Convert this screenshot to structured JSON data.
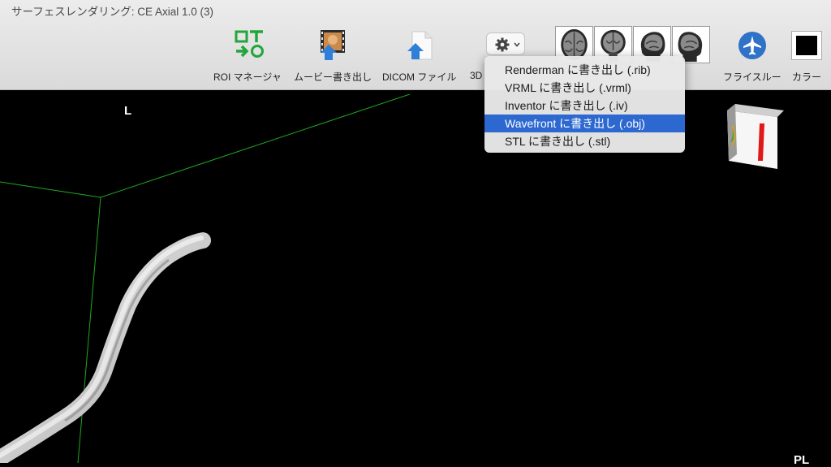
{
  "window": {
    "title": "サーフェスレンダリング: CE Axial 1.0 (3)"
  },
  "toolbar": {
    "roi_label": "ROI マネージャ",
    "movie_label": "ムービー書き出し",
    "dicom_label": "DICOM ファイル",
    "threed_label": "3D",
    "flythrough_label": "フライスルー",
    "color_label": "カラー"
  },
  "menu": {
    "items": [
      {
        "label": "Renderman に書き出し (.rib)"
      },
      {
        "label": "VRML に書き出し (.vrml)"
      },
      {
        "label": "Inventor に書き出し (.iv)"
      },
      {
        "label": "Wavefront に書き出し (.obj)",
        "selected": true
      },
      {
        "label": "STL に書き出し (.stl)"
      }
    ]
  },
  "viewport": {
    "orientation_top": "L",
    "orientation_bottom_right": "PL"
  },
  "colors": {
    "accent": "#2c68d0",
    "roi_icon": "#21a63a",
    "bounding_box": "#1ea81e",
    "flythrough_icon": "#2f72c8"
  }
}
